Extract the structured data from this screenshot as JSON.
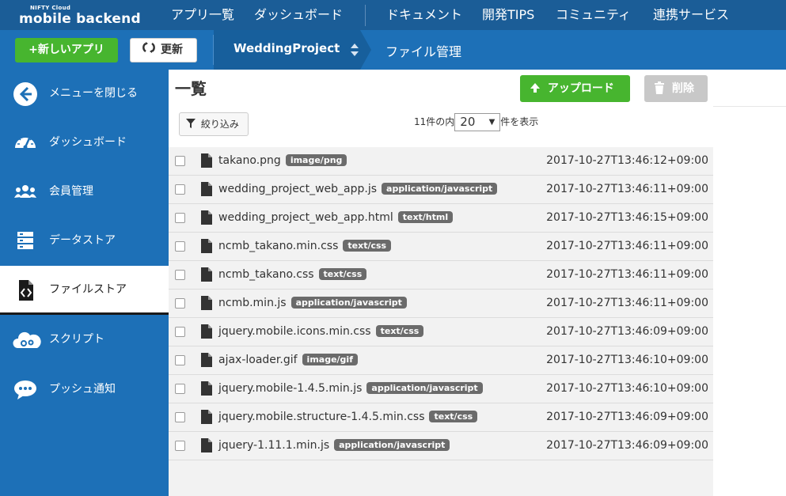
{
  "app": {
    "logo_small": "NIFTY Cloud",
    "logo_big": "mobile backend"
  },
  "topnav": [
    {
      "label": "アプリ一覧"
    },
    {
      "label": "ダッシュボード"
    },
    {
      "label": "ドキュメント"
    },
    {
      "label": "開発TIPS"
    },
    {
      "label": "コミュニティ"
    },
    {
      "label": "連携サービス"
    }
  ],
  "subbar": {
    "new_app_label": "+新しいアプリ",
    "refresh_label": "更新",
    "project_name": "WeddingProject",
    "page_crumb": "ファイル管理"
  },
  "sidebar": {
    "items": [
      {
        "label": "メニューを閉じる",
        "icon": "arrow-left-circle-icon"
      },
      {
        "label": "ダッシュボード",
        "icon": "speedometer-icon"
      },
      {
        "label": "会員管理",
        "icon": "users-icon"
      },
      {
        "label": "データストア",
        "icon": "database-icon"
      },
      {
        "label": "ファイルストア",
        "icon": "file-code-icon",
        "active": true
      },
      {
        "label": "スクリプト",
        "icon": "cloud-gears-icon"
      },
      {
        "label": "プッシュ通知",
        "icon": "chat-bubble-icon"
      }
    ]
  },
  "main": {
    "title": "一覧",
    "upload_label": "アップロード",
    "delete_label": "削除",
    "filter_label": "絞り込み",
    "pager_prefix": "11件の内",
    "pager_value": "20",
    "pager_suffix": "件を表示",
    "files": [
      {
        "name": "takano.png",
        "type": "image/png",
        "date": "2017-10-27T13:46:12+09:00"
      },
      {
        "name": "wedding_project_web_app.js",
        "type": "application/javascript",
        "date": "2017-10-27T13:46:11+09:00"
      },
      {
        "name": "wedding_project_web_app.html",
        "type": "text/html",
        "date": "2017-10-27T13:46:15+09:00"
      },
      {
        "name": "ncmb_takano.min.css",
        "type": "text/css",
        "date": "2017-10-27T13:46:11+09:00"
      },
      {
        "name": "ncmb_takano.css",
        "type": "text/css",
        "date": "2017-10-27T13:46:11+09:00"
      },
      {
        "name": "ncmb.min.js",
        "type": "application/javascript",
        "date": "2017-10-27T13:46:11+09:00"
      },
      {
        "name": "jquery.mobile.icons.min.css",
        "type": "text/css",
        "date": "2017-10-27T13:46:09+09:00"
      },
      {
        "name": "ajax-loader.gif",
        "type": "image/gif",
        "date": "2017-10-27T13:46:10+09:00"
      },
      {
        "name": "jquery.mobile-1.4.5.min.js",
        "type": "application/javascript",
        "date": "2017-10-27T13:46:10+09:00"
      },
      {
        "name": "jquery.mobile.structure-1.4.5.min.css",
        "type": "text/css",
        "date": "2017-10-27T13:46:09+09:00"
      },
      {
        "name": "jquery-1.11.1.min.js",
        "type": "application/javascript",
        "date": "2017-10-27T13:46:09+09:00"
      }
    ]
  },
  "colors": {
    "topbar": "#1b5d97",
    "subbar": "#1d70b7",
    "accent_green": "#47b52f",
    "badge_gray": "#6b6b6b"
  }
}
